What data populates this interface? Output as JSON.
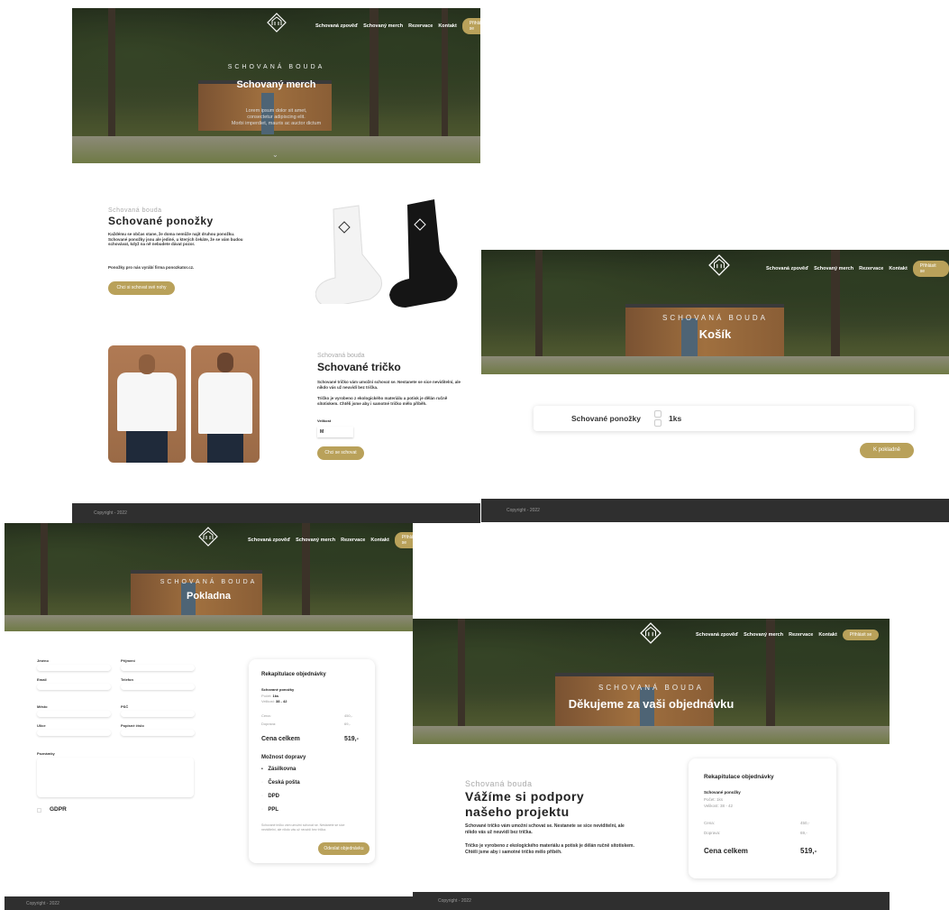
{
  "nav": {
    "links": [
      "Schovaná zpověď",
      "Schovaný merch",
      "Rezervace",
      "Kontakt"
    ],
    "button": "Přihlásit se"
  },
  "brand": {
    "kicker": "SCHOVANÁ BOUDA",
    "small": "Schovaná bouda"
  },
  "merch": {
    "hero_title": "Schovaný merch",
    "hero_lorem": [
      "Lorem ipsum dolor sit amet,",
      "consectetur adipiscing elit.",
      "Morbi imperdiet, mauris ac auctor dictum"
    ],
    "socks": {
      "title": "Schované ponožky",
      "text": "Každému se občas stane, že doma nemůže najít druhou ponožku. Schované ponožky jsou ale jediné, u kterých čekáte, že se vám budou schovávat, když na ně nebudete dávat pozor.",
      "maker": "Ponožky pro nás vyrábí firma ponozkator.cz.",
      "button": "Chci si schovat své nohy"
    },
    "shirt": {
      "title": "Schované tričko",
      "text1": "Schované tričko vám umožní schovat se. Nestanete se sice neviditelní, ale nikdo vás už neuvidí bez trička.",
      "text2": "Tričko je vyrobeno z ekologického materiálu a potisk je dělán ručně sítotiskem. Chtěli jsme aby i samotné tričko mělo příběh.",
      "size_label": "Velikost",
      "size_value": "M",
      "button": "Chci se schovat"
    },
    "footer": "Copyright - 2022"
  },
  "cart": {
    "hero_title": "Košík",
    "item_name": "Schované ponožky",
    "qty": "1ks",
    "button": "K pokladně",
    "footer": "Copyright - 2022"
  },
  "checkout": {
    "hero_title": "Pokladna",
    "fields": [
      "Jméno",
      "Příjmení",
      "Email",
      "Telefon",
      "Město",
      "PSČ",
      "Ulice",
      "Popisné číslo",
      "Poznámky"
    ],
    "gdpr": "GDPR",
    "summary": {
      "title": "Rekapitulace objednávky",
      "item": "Schované ponožky",
      "count_label": "Počet:",
      "count": "1ks",
      "size_label": "Velikost:",
      "size": "38 - 42",
      "price_label": "Cena:",
      "price": "450,-",
      "shipping_label": "Doprava:",
      "shipping": "69,-",
      "total_label": "Cena celkem",
      "total": "519,-",
      "delivery_title": "Možnost dopravy",
      "delivery": [
        "Zásilkovna",
        "Česká pošta",
        "DPD",
        "PPL"
      ],
      "note": "Schované tričko vám umožní schovat se. Nestanete se sice neviditelní, ale nikdo vás už neuvidí bez trička.",
      "button": "Odeslat objednávku"
    },
    "footer": "Copyright - 2022"
  },
  "thanks": {
    "hero_title": "Děkujeme za vaši objednávku",
    "heading_line1": "Vážíme si podpory",
    "heading_line2": "našeho projektu",
    "text1": "Schované tričko vám umožní schovat se. Nestanete se sice neviditelní, ale nikdo vás už neuvidí bez trička.",
    "text2": "Tričko je vyrobeno z ekologického materiálu a potisk je dělán ručně sítotiskem. Chtěli jsme aby i samotné tričko mělo příběh.",
    "summary": {
      "title": "Rekapitulace objednávky",
      "item": "Schované ponožky",
      "count": "Počet: 1ks",
      "size": "Velikost: 38 - 42",
      "price_label": "Cena:",
      "price": "450,-",
      "shipping_label": "Doprava:",
      "shipping": "69,-",
      "total_label": "Cena celkem",
      "total": "519,-"
    },
    "footer": "Copyright - 2022"
  }
}
